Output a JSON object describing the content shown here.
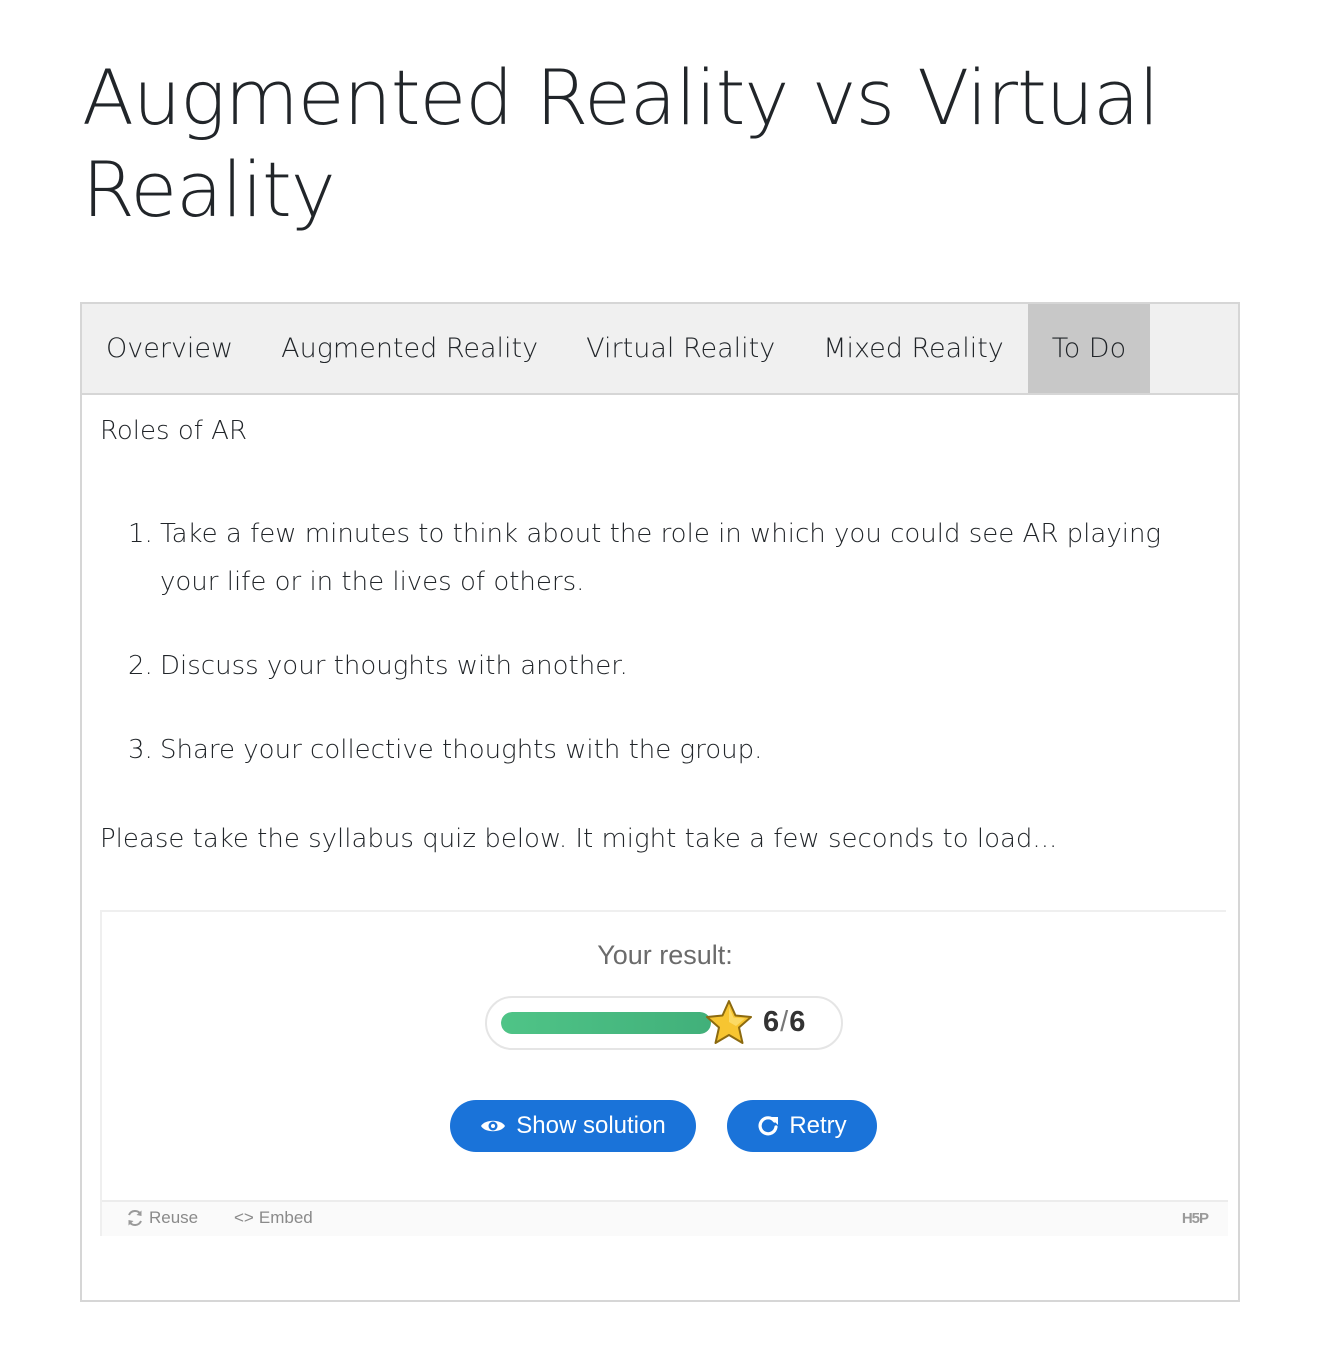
{
  "page": {
    "title": "Augmented Reality vs Virtual Reality"
  },
  "tabs": [
    {
      "label": "Overview",
      "active": false
    },
    {
      "label": "Augmented Reality",
      "active": false
    },
    {
      "label": "Virtual Reality",
      "active": false
    },
    {
      "label": "Mixed Reality",
      "active": false
    },
    {
      "label": "To Do",
      "active": true
    }
  ],
  "content": {
    "heading": "Roles of AR",
    "steps": [
      {
        "number": "1.",
        "text": "Take a few minutes to think about the role in which you could see AR playing your life or in the lives of others."
      },
      {
        "number": "2.",
        "text": "Discuss your thoughts with another."
      },
      {
        "number": "3.",
        "text": "Share your collective thoughts with the group."
      }
    ],
    "quiz_intro": "Please take the syllabus quiz below. It might take a few seconds to load..."
  },
  "quiz": {
    "result_label": "Your result:",
    "score": "6",
    "score_separator": "/",
    "max_score": "6",
    "progress_fraction": 1.0,
    "show_solution_label": "Show solution",
    "retry_label": "Retry",
    "footer": {
      "reuse_label": "Reuse",
      "embed_label": "Embed",
      "logo_text": "H5P"
    }
  },
  "colors": {
    "button_blue": "#1a73d9",
    "progress_green": "#4fc487",
    "active_tab": "#c8c8c8",
    "tab_bar": "#f0f0f0"
  }
}
